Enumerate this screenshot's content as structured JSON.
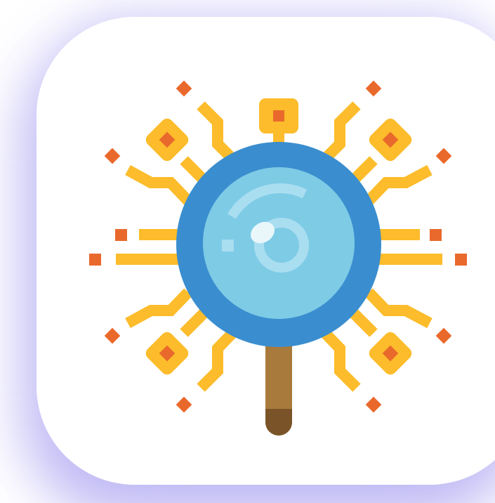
{
  "app_icon": {
    "name": "magnifying-glass-circuit-icon",
    "colors": {
      "background_glow": "#b9b2f3",
      "tile": "#ffffff",
      "circuit_trace": "#fcbc2b",
      "node_fill": "#fcbc2b",
      "node_dot": "#e9692c",
      "lens_rim": "#3a8ecf",
      "lens_glass": "#7ecbe6",
      "lens_highlight": "#a9def0",
      "handle": "#a87a3c",
      "handle_cap": "#7a5428"
    }
  }
}
